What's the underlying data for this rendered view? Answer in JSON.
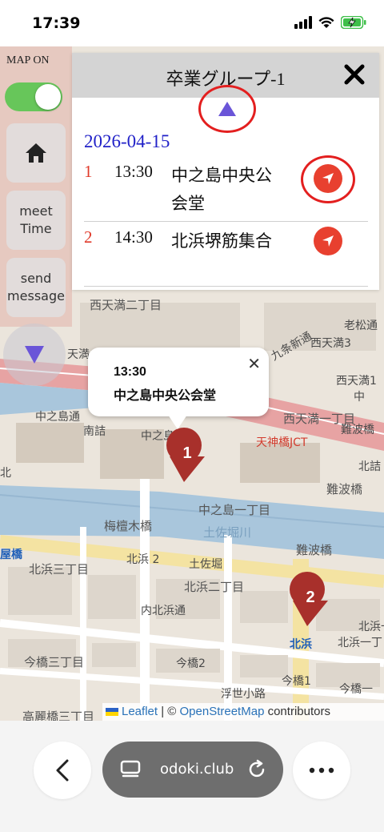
{
  "status": {
    "time": "17:39"
  },
  "controls": {
    "map_on_label": "MAP ON",
    "home_icon": "home-icon",
    "meet_time_label_1": "meet",
    "meet_time_label_2": "Time",
    "send_message_label_1": "send",
    "send_message_label_2": "message"
  },
  "panel": {
    "title": "卒業グループ-1",
    "date": "2026-04-15",
    "entries": [
      {
        "num": "1",
        "time": "13:30",
        "place": "中之島中央公会堂"
      },
      {
        "num": "2",
        "time": "14:30",
        "place": "北浜堺筋集合"
      }
    ]
  },
  "popup": {
    "time": "13:30",
    "place": "中之島中央公会堂"
  },
  "markers": [
    {
      "label": "1"
    },
    {
      "label": "2"
    }
  ],
  "map_labels": {
    "l1": "西天満二丁目",
    "l2": "西天満3",
    "l3": "老松通",
    "l4": "九条新通",
    "l5": "西天満1",
    "l6": "中",
    "l7": "西天満一丁目",
    "l8": "天満",
    "l9": "中之島通",
    "l10": "南詰",
    "l11": "中之島",
    "l12": "天神橋JCT",
    "l13": "難波橋",
    "l14": "北詰",
    "l15": "難波橋",
    "l16": "中之島一丁目",
    "l17": "梅檀木橋",
    "l18": "土佐堀川",
    "l19": "難波橋",
    "l20": "北浜 2",
    "l21": "土佐堀",
    "l22": "屋橋",
    "l23": "北浜三丁目",
    "l24": "北浜二丁目",
    "l25": "北浜",
    "l26": "北浜一",
    "l27": "北浜一丁目",
    "l28": "内北浜通",
    "l29": "今橋三丁目",
    "l30": "今橋2",
    "l31": "今橋1",
    "l32": "浮世小路",
    "l33": "高麗橋三丁目",
    "l34": "北",
    "l35": "今橋一",
    "l36": "南詰"
  },
  "attribution": {
    "leaflet": "Leaflet",
    "sep": "| ©",
    "osm": "OpenStreetMap",
    "rest": "contributors"
  },
  "browser": {
    "url": "odoki.club"
  }
}
